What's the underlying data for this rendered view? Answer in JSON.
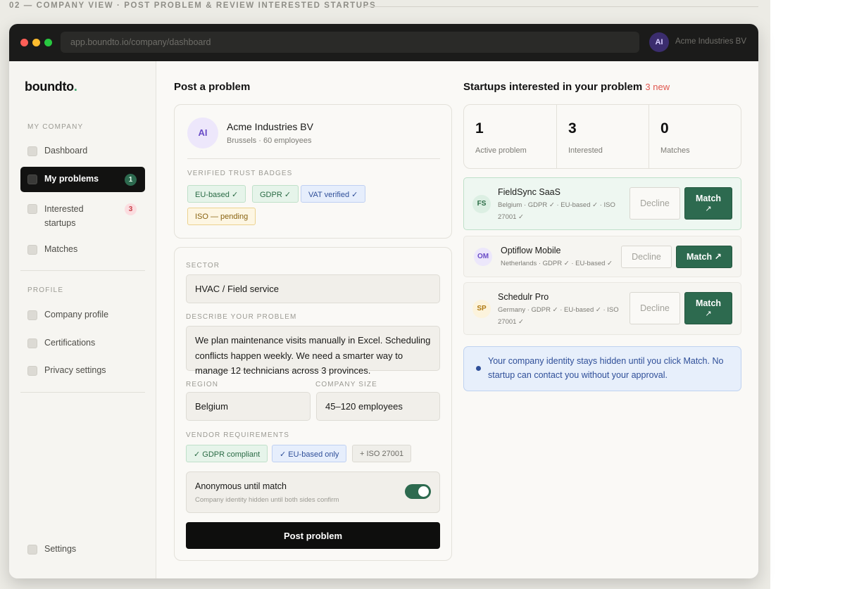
{
  "caption": "02 — COMPANY VIEW · POST PROBLEM & REVIEW INTERESTED STARTUPS",
  "browser": {
    "url": "app.boundto.io/company/dashboard",
    "user_initials": "AI",
    "user_name": "Acme Industries BV"
  },
  "sidebar": {
    "logo": "boundto",
    "logo_dot": ".",
    "section_company": "MY COMPANY",
    "items_company": [
      {
        "label": "Dashboard"
      },
      {
        "label": "My problems",
        "count": "1"
      },
      {
        "label": "Interested startups",
        "count": "3"
      },
      {
        "label": "Matches"
      }
    ],
    "section_profile": "PROFILE",
    "items_profile": [
      {
        "label": "Company profile"
      },
      {
        "label": "Certifications"
      },
      {
        "label": "Privacy settings"
      }
    ],
    "settings_label": "Settings"
  },
  "post": {
    "title": "Post a problem",
    "company": {
      "initials": "AI",
      "name": "Acme Industries BV",
      "meta": "Brussels · 60 employees",
      "badges_label": "VERIFIED TRUST BADGES",
      "badges": [
        "EU-based ✓",
        "GDPR ✓",
        "VAT verified ✓",
        "ISO — pending"
      ]
    },
    "form": {
      "sector_label": "SECTOR",
      "sector_value": "HVAC / Field service",
      "describe_label": "DESCRIBE YOUR PROBLEM",
      "describe_value": "We plan maintenance visits manually in Excel. Scheduling conflicts happen weekly. We need a smarter way to manage 12 technicians across 3 provinces.",
      "region_label": "REGION",
      "region_value": "Belgium",
      "size_label": "COMPANY SIZE",
      "size_value": "45–120 employees",
      "vendor_label": "VENDOR REQUIREMENTS",
      "vendor_reqs": [
        "✓ GDPR compliant",
        "✓ EU-based only",
        "+ ISO 27001"
      ],
      "anon_title": "Anonymous until match",
      "anon_sub": "Company identity hidden until both sides confirm",
      "anon_enabled": true,
      "submit_label": "Post problem"
    }
  },
  "interested": {
    "title": "Startups interested in your problem",
    "new_badge": "3 new",
    "stats": [
      {
        "value": "1",
        "label": "Active problem"
      },
      {
        "value": "3",
        "label": "Interested"
      },
      {
        "value": "0",
        "label": "Matches"
      }
    ],
    "startups": [
      {
        "initials": "FS",
        "name": "FieldSync SaaS",
        "meta": "Belgium · GDPR ✓ · EU-based ✓ · ISO 27001 ✓",
        "decline": "Decline",
        "match": "Match",
        "match_arrow": "↗"
      },
      {
        "initials": "OM",
        "name": "Optiflow Mobile",
        "meta": "Netherlands · GDPR ✓ · EU-based ✓",
        "decline": "Decline",
        "match": "Match ↗"
      },
      {
        "initials": "SP",
        "name": "Schedulr Pro",
        "meta": "Germany · GDPR ✓ · EU-based ✓ · ISO 27001 ✓",
        "decline": "Decline",
        "match": "Match",
        "match_arrow": "↗"
      }
    ],
    "info_text": "Your company identity stays hidden until you click Match. No startup can contact you without your approval."
  },
  "colors": {
    "accent_green": "#2d6a4f",
    "new_red": "#e0574f",
    "info_blue": "#2f4f99"
  }
}
